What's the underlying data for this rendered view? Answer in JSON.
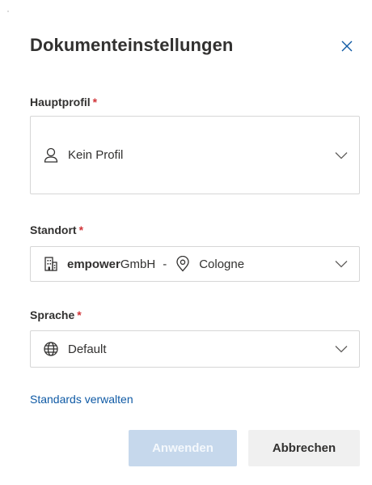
{
  "panel": {
    "title": "Dokumenteinstellungen"
  },
  "main_profile": {
    "label": "Hauptprofil",
    "required_marker": "*",
    "value": "Kein Profil",
    "icon": "user-icon"
  },
  "location": {
    "label": "Standort",
    "required_marker": "*",
    "company_bold": "empower",
    "company_rest": "GmbH",
    "separator": "-",
    "city": "Cologne",
    "icons": [
      "building-icon",
      "location-pin-icon"
    ]
  },
  "language": {
    "label": "Sprache",
    "required_marker": "*",
    "value": "Default",
    "icon": "globe-icon"
  },
  "manage_defaults_link": "Standards verwalten",
  "buttons": {
    "apply": "Anwenden",
    "cancel": "Abbrechen"
  },
  "colors": {
    "required": "#d13438",
    "link": "#0f5aa5",
    "apply_disabled_bg": "#c6d8ec",
    "cancel_bg": "#f0f0f0"
  }
}
